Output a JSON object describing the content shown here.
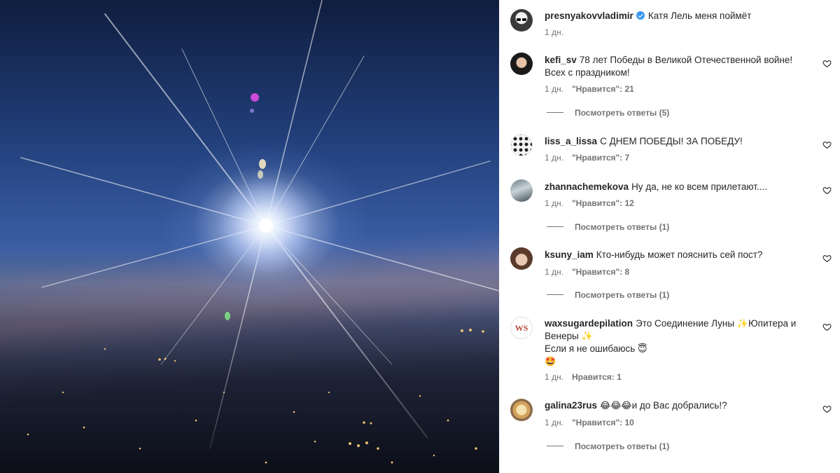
{
  "post": {
    "author": "presnyakovvladimir",
    "caption": "Катя Лель меня поймёт",
    "time": "1 дн."
  },
  "comments": [
    {
      "user": "kefi_sv",
      "text": "78 лет Победы в Великой Отечественной войне! Всех с праздником!",
      "time": "1 дн.",
      "likes": "\"Нравится\": 21",
      "replies": "Посмотреть ответы (5)"
    },
    {
      "user": "liss_a_lissa",
      "text": "С ДНЕМ ПОБЕДЫ! ЗА ПОБЕДУ!",
      "time": "1 дн.",
      "likes": "\"Нравится\": 7"
    },
    {
      "user": "zhannachemekova",
      "text": "Ну да, не ко всем прилетают....",
      "time": "1 дн.",
      "likes": "\"Нравится\": 12",
      "replies": "Посмотреть ответы (1)"
    },
    {
      "user": "ksuny_iam",
      "text": "Кто-нибудь может пояснить сей пост?",
      "time": "1 дн.",
      "likes": "\"Нравится\": 8",
      "replies": "Посмотреть ответы (1)"
    },
    {
      "user": "waxsugardepilation",
      "text_part1": "Это Соединение Луны",
      "text_part2": "Юпитера и Венеры",
      "text_line2": "Если я не ошибаюсь",
      "sparkle": "✨",
      "smile": "😇",
      "star_eyes": "🤩",
      "time": "1 дн.",
      "likes": "Нравится: 1",
      "avatar_letters": "WS"
    },
    {
      "user": "galina23rus",
      "laughs": "😂😂😂",
      "text": "и до Вас добрались!?",
      "time": "1 дн.",
      "likes": "\"Нравится\": 10",
      "replies": "Посмотреть ответы (1)"
    }
  ],
  "icons": {
    "like": "heart-outline-icon",
    "verified": "verified-badge-icon"
  },
  "colors": {
    "verified": "#3897f0",
    "secondary_text": "#737373",
    "primary_text": "#262626"
  }
}
